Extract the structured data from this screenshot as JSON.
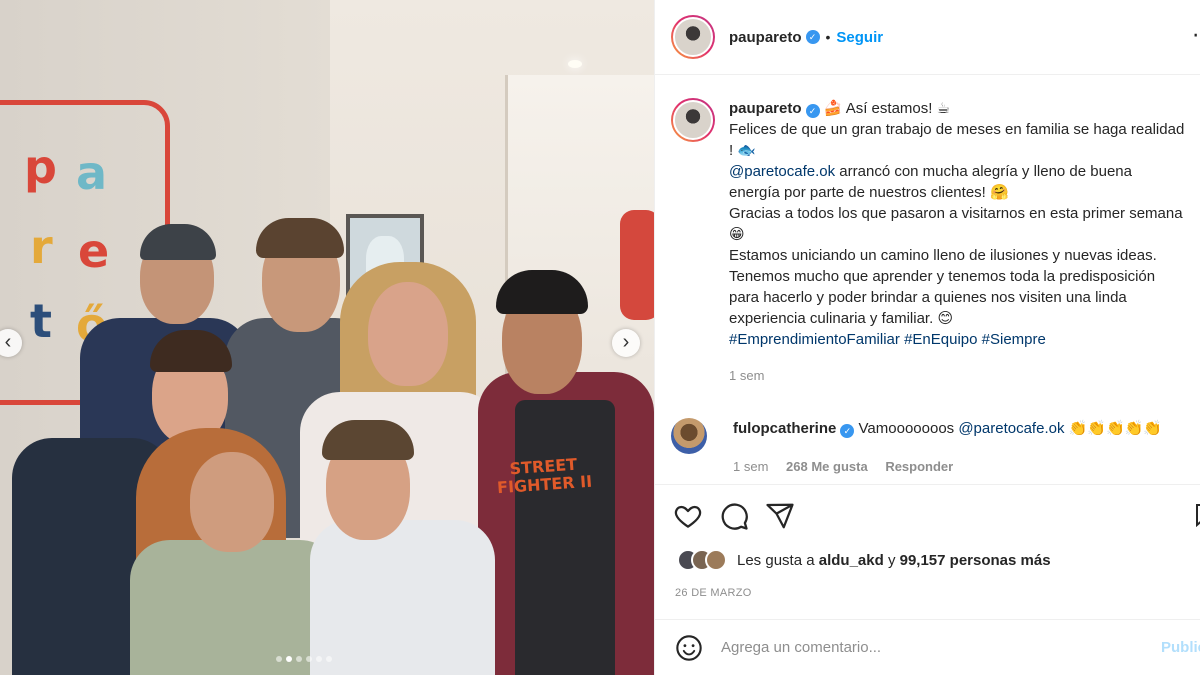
{
  "post": {
    "username": "paupareto",
    "follow_label": "Seguir",
    "more_icon": "more-dots-icon",
    "caption": {
      "title": "Así estamos!",
      "lines": [
        "Felices de que un gran trabajo de meses en familia se haga realidad",
        "!",
        "arrancó con mucha alegría y lleno de buena",
        "energía por parte de nuestros clientes!",
        "Gracias a todos los que pasaron a visitarnos en esta primer semana",
        "Estamos uniciando un camino lleno de ilusiones y nuevas ideas.",
        "Tenemos mucho que aprender y tenemos toda la predisposición",
        "para hacerlo y poder brindar a quienes nos visiten una linda",
        "experiencia culinaria y familiar."
      ],
      "mention": "@paretocafe.ok",
      "hashtags": [
        "#EmprendimientoFamiliar",
        "#EnEquipo",
        "#Siempre"
      ],
      "time": "1 sem"
    },
    "comment": {
      "username": "fulopcatherine",
      "text": "Vamooooooos",
      "mention": "@paretocafe.ok",
      "time": "1 sem",
      "likes": "268 Me gusta",
      "reply_label": "Responder"
    },
    "likes": {
      "prefix": "Les gusta a",
      "user": "aldu_akd",
      "middle": "y",
      "count": "99,157 personas más"
    },
    "date": "26 DE MARZO",
    "comment_input": {
      "placeholder": "Agrega un comentario..."
    },
    "publish_label": "Publicar"
  },
  "photo": {
    "logo_letters": [
      "pa",
      "re",
      "tč"
    ],
    "shirt_text": "STREET FIGHTER II",
    "carousel_dots": 6,
    "active_dot": 1
  },
  "colors": {
    "accent": "#0095f6",
    "link": "#00376b",
    "logo_red": "#d9473a"
  }
}
